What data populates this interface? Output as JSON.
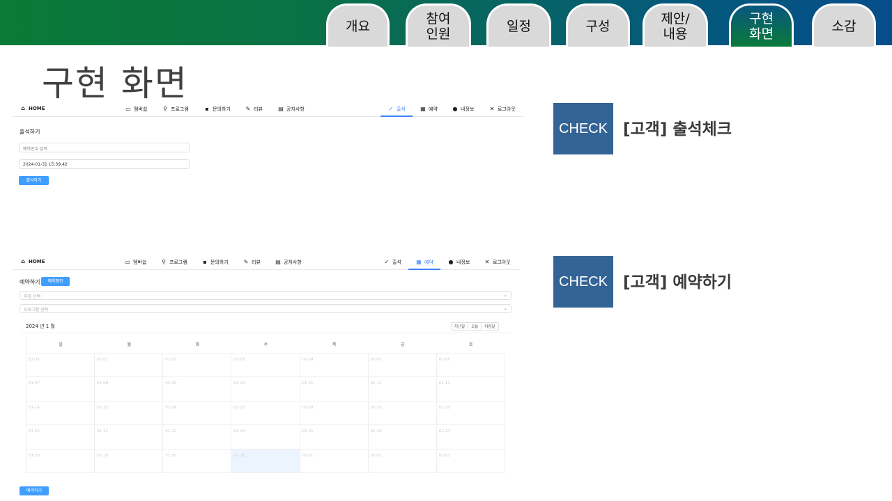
{
  "tabs": [
    {
      "label": "개요"
    },
    {
      "label": "참여\n인원"
    },
    {
      "label": "일정"
    },
    {
      "label": "구성"
    },
    {
      "label": "제안/\n내용"
    },
    {
      "label": "구현\n화면"
    },
    {
      "label": "소감"
    }
  ],
  "active_tab": "구현 화면",
  "page_title": "구현 화면",
  "nav": {
    "home": "HOME",
    "membership": "멤버쉽",
    "program": "프로그램",
    "inquiry": "문의하기",
    "review": "리뷰",
    "notice": "공지사항",
    "attendance": "출석",
    "reservation": "예약",
    "myinfo": "내정보",
    "logout": "로그아웃"
  },
  "attendance_screen": {
    "heading": "출석하기",
    "input_placeholder": "예약번호 입력",
    "datetime_value": "2024-01-31 15:39:42",
    "submit_label": "출석하기"
  },
  "reservation_screen": {
    "heading": "예약하기",
    "confirm_label": "예약확인",
    "branch_placeholder": "지점 선택",
    "program_placeholder": "프로그램 선택",
    "calendar_title": "2024 년 1 월",
    "prev_label": "지난달",
    "today_label": "오늘",
    "next_label": "다음달",
    "weekdays": [
      "일",
      "월",
      "화",
      "수",
      "목",
      "금",
      "토"
    ],
    "dates": [
      "12-31",
      "01-01",
      "01-02",
      "01-03",
      "01-04",
      "01-05",
      "01-06",
      "01-07",
      "01-08",
      "01-09",
      "01-10",
      "01-11",
      "01-12",
      "01-13",
      "01-14",
      "01-15",
      "01-16",
      "01-17",
      "01-18",
      "01-19",
      "01-20",
      "01-21",
      "01-22",
      "01-23",
      "01-24",
      "01-25",
      "01-26",
      "01-27",
      "01-28",
      "01-29",
      "01-30",
      "01-31",
      "02-01",
      "02-02",
      "02-03"
    ],
    "submit_label": "예약하기"
  },
  "features": [
    {
      "badge": "CHECK",
      "title": "[고객] 출석체크"
    },
    {
      "badge": "CHECK",
      "title": "[고객] 예약하기"
    }
  ],
  "colors": {
    "accent": "#409eff",
    "badge": "#346496",
    "active_tab_top": "#08567f",
    "active_tab_bottom": "#0a7a3a"
  }
}
